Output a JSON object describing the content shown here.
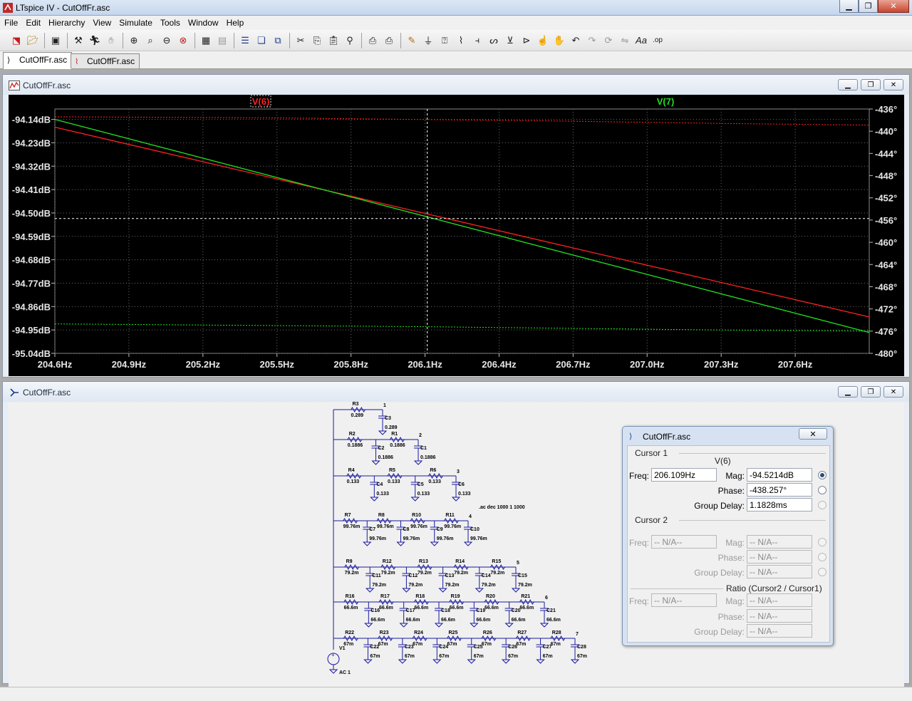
{
  "app": {
    "title": "LTspice IV - CutOffFr.asc",
    "menu": [
      "File",
      "Edit",
      "Hierarchy",
      "View",
      "Simulate",
      "Tools",
      "Window",
      "Help"
    ],
    "tabs": [
      {
        "label": "CutOffFr.asc",
        "active": true
      },
      {
        "label": "CutOffFr.asc",
        "active": false
      }
    ]
  },
  "plot_window": {
    "title": "CutOffFr.asc",
    "trace_labels": [
      "V(6)",
      "V(7)"
    ],
    "trace_colors": [
      "#ff2020",
      "#20e020"
    ]
  },
  "schematic_window": {
    "title": "CutOffFr.asc",
    "directive": ".ac dec 1000 1 1000",
    "source_label": "V1",
    "source_value": "AC 1",
    "rows": [
      {
        "node": "1",
        "comps": [
          [
            "R3",
            "0.289"
          ],
          [
            "C3",
            "0.289"
          ]
        ]
      },
      {
        "node": "2",
        "comps": [
          [
            "R2",
            "0.1886"
          ],
          [
            "R1",
            "0.1886"
          ],
          [
            "C2",
            "0.1886"
          ],
          [
            "C1",
            "0.1886"
          ]
        ]
      },
      {
        "node": "3",
        "comps": [
          [
            "R4",
            "0.133"
          ],
          [
            "R5",
            "0.133"
          ],
          [
            "R6",
            "0.133"
          ],
          [
            "C4",
            "0.133"
          ],
          [
            "C5",
            "0.133"
          ],
          [
            "C6",
            "0.133"
          ]
        ]
      },
      {
        "node": "4",
        "comps": [
          [
            "R7",
            "99.76m"
          ],
          [
            "R8",
            "99.76m"
          ],
          [
            "R10",
            "99.76m"
          ],
          [
            "R11",
            "99.76m"
          ],
          [
            "C7",
            "99.76m"
          ],
          [
            "C8",
            "99.76m"
          ],
          [
            "C9",
            "99.76m"
          ],
          [
            "C10",
            "99.76m"
          ]
        ]
      },
      {
        "node": "5",
        "comps": [
          [
            "R9",
            "79.2m"
          ],
          [
            "R12",
            "79.2m"
          ],
          [
            "R13",
            "79.2m"
          ],
          [
            "R14",
            "79.2m"
          ],
          [
            "R15",
            "79.2m"
          ],
          [
            "C11",
            "79.2m"
          ],
          [
            "C12",
            "79.2m"
          ],
          [
            "C13",
            "79.2m"
          ],
          [
            "C14",
            "79.2m"
          ],
          [
            "C15",
            "79.2m"
          ]
        ]
      },
      {
        "node": "6",
        "comps": [
          [
            "R16",
            "66.6m"
          ],
          [
            "R17",
            "66.6m"
          ],
          [
            "R18",
            "66.6m"
          ],
          [
            "R19",
            "66.6m"
          ],
          [
            "R20",
            "66.6m"
          ],
          [
            "R21",
            "66.6m"
          ],
          [
            "C16",
            "66.6m"
          ],
          [
            "C17",
            "66.6m"
          ],
          [
            "C18",
            "66.6m"
          ],
          [
            "C19",
            "66.6m"
          ],
          [
            "C20",
            "66.6m"
          ],
          [
            "C21",
            "66.6m"
          ]
        ]
      },
      {
        "node": "7",
        "comps": [
          [
            "R22",
            "67m"
          ],
          [
            "R23",
            "67m"
          ],
          [
            "R24",
            "67m"
          ],
          [
            "R25",
            "67m"
          ],
          [
            "R26",
            "67m"
          ],
          [
            "R27",
            "67m"
          ],
          [
            "R28",
            "67m"
          ],
          [
            "C22",
            "67m"
          ],
          [
            "C23",
            "67m"
          ],
          [
            "C24",
            "67m"
          ],
          [
            "C25",
            "67m"
          ],
          [
            "C26",
            "67m"
          ],
          [
            "C27",
            "67m"
          ],
          [
            "C28",
            "67m"
          ]
        ]
      }
    ]
  },
  "cursor_dialog": {
    "title": "CutOffFr.asc",
    "cursor1": {
      "group": "Cursor 1",
      "trace": "V(6)",
      "freq_label": "Freq:",
      "freq": "206.109Hz",
      "mag_label": "Mag:",
      "mag": "-94.5214dB",
      "phase_label": "Phase:",
      "phase": "-438.257°",
      "gd_label": "Group Delay:",
      "gd": "1.1828ms"
    },
    "cursor2": {
      "group": "Cursor 2",
      "freq_label": "Freq:",
      "freq": "-- N/A--",
      "mag_label": "Mag:",
      "mag": "-- N/A--",
      "phase_label": "Phase:",
      "phase": "-- N/A--",
      "gd_label": "Group Delay:",
      "gd": "-- N/A--"
    },
    "ratio": {
      "group": "Ratio (Cursor2 / Cursor1)",
      "freq_label": "Freq:",
      "freq": "-- N/A--",
      "mag_label": "Mag:",
      "mag": "-- N/A--",
      "phase_label": "Phase:",
      "phase": "-- N/A--",
      "gd_label": "Group Delay:",
      "gd": "-- N/A--"
    }
  },
  "chart_data": {
    "type": "line",
    "x_ticks": [
      "204.6Hz",
      "204.9Hz",
      "205.2Hz",
      "205.5Hz",
      "205.8Hz",
      "206.1Hz",
      "206.4Hz",
      "206.7Hz",
      "207.0Hz",
      "207.3Hz",
      "207.6Hz"
    ],
    "y_left_ticks": [
      "-94.14dB",
      "-94.23dB",
      "-94.32dB",
      "-94.41dB",
      "-94.50dB",
      "-94.59dB",
      "-94.68dB",
      "-94.77dB",
      "-94.86dB",
      "-94.95dB",
      "-95.04dB"
    ],
    "y_right_ticks": [
      "-436°",
      "-440°",
      "-444°",
      "-448°",
      "-452°",
      "-456°",
      "-460°",
      "-464°",
      "-468°",
      "-472°",
      "-476°",
      "-480°"
    ],
    "xlim": [
      204.6,
      207.9
    ],
    "ylim_mag_db": [
      -95.04,
      -94.1
    ],
    "ylim_phase_deg": [
      -480,
      -436
    ],
    "series": [
      {
        "name": "V(6)",
        "color": "#ff2020",
        "mag_db": {
          "x": [
            204.6,
            207.9
          ],
          "y": [
            -94.17,
            -94.9
          ]
        },
        "phase_deg": {
          "x": [
            204.6,
            205.5,
            206.1,
            206.7,
            207.3,
            207.9
          ],
          "y": [
            -437.4,
            -437.6,
            -437.9,
            -438.2,
            -438.6,
            -438.9
          ]
        }
      },
      {
        "name": "V(7)",
        "color": "#20e020",
        "mag_db": {
          "x": [
            204.6,
            207.9
          ],
          "y": [
            -94.14,
            -94.96
          ]
        },
        "phase_deg": {
          "x": [
            204.6,
            205.5,
            206.1,
            206.7,
            207.3,
            207.9
          ],
          "y": [
            -474.7,
            -475.0,
            -475.2,
            -475.5,
            -475.8,
            -476.0
          ]
        }
      }
    ],
    "cursor": {
      "x": 206.109,
      "y": -94.5214
    }
  }
}
